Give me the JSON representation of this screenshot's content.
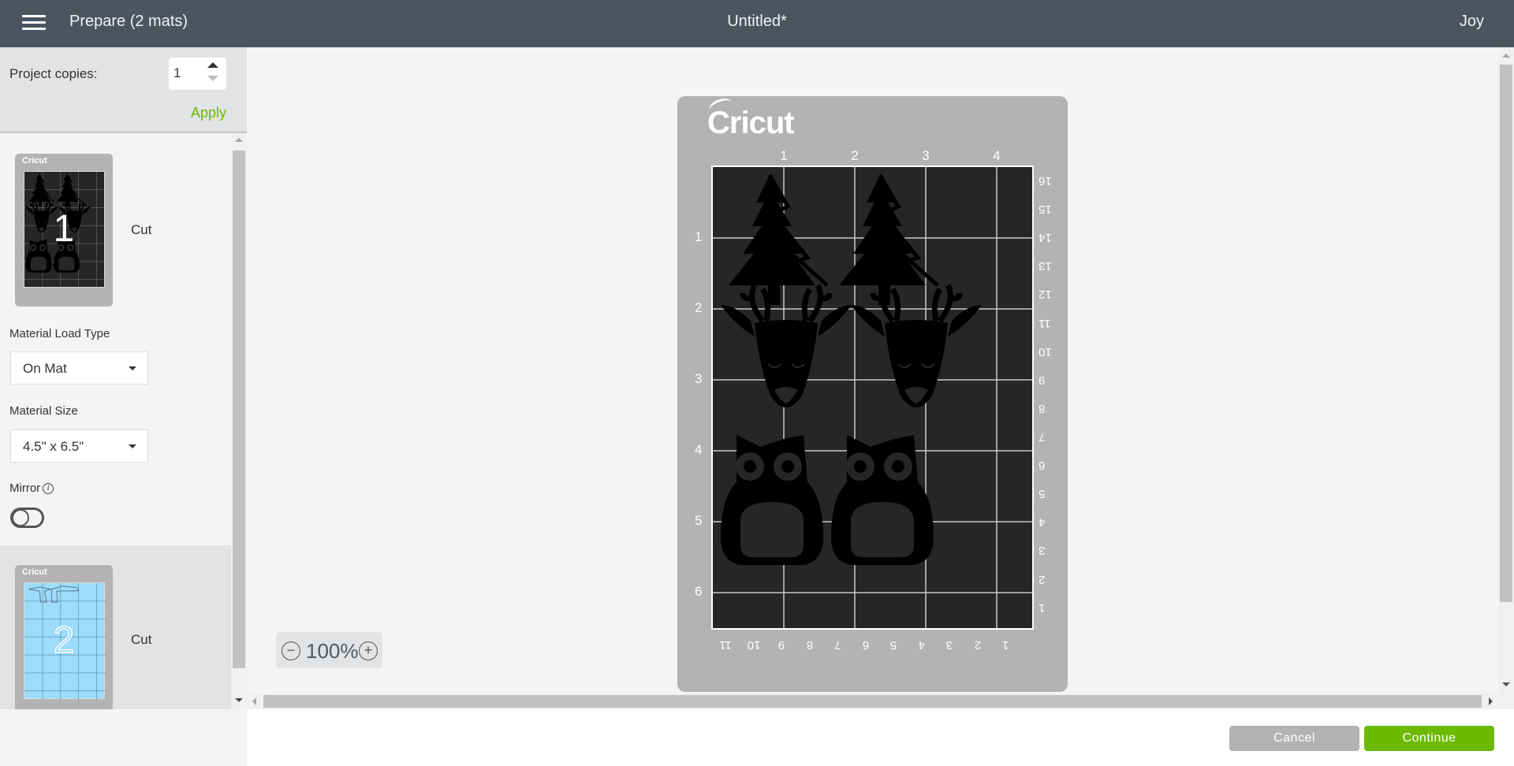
{
  "header": {
    "menu_icon": "hamburger-menu-icon",
    "title": "Prepare (2 mats)",
    "project_name": "Untitled*",
    "user": "Joy"
  },
  "sidebar": {
    "project_copies_label": "Project copies:",
    "project_copies_value": "1",
    "apply_label": "Apply",
    "mats": [
      {
        "number": "1",
        "brand": "Cricut",
        "action": "Cut",
        "material_color": "#262626",
        "contents": [
          "tree",
          "tree",
          "deer",
          "deer",
          "owl",
          "owl"
        ]
      },
      {
        "number": "2",
        "brand": "Cricut",
        "action": "Cut",
        "material_color": "#9edcfb",
        "contents": [
          "outline-shape",
          "outline-shape"
        ]
      }
    ],
    "material_load_type_label": "Material Load Type",
    "material_load_type_value": "On Mat",
    "material_size_label": "Material Size",
    "material_size_value": "4.5\" x 6.5\"",
    "mirror_label": "Mirror",
    "mirror_on": false
  },
  "canvas": {
    "mat": {
      "brand": "Cricut",
      "material_color": "#262626",
      "width_in": 4.5,
      "height_in": 6.5,
      "ruler_top": [
        "1",
        "2",
        "3",
        "4"
      ],
      "ruler_left": [
        "1",
        "2",
        "3",
        "4",
        "5",
        "6"
      ],
      "ruler_right": [
        "16",
        "15",
        "14",
        "13",
        "12",
        "11",
        "10",
        "9",
        "8",
        "7",
        "6",
        "5",
        "4",
        "3",
        "2",
        "1"
      ],
      "ruler_bottom": [
        "11",
        "10",
        "9",
        "8",
        "7",
        "6",
        "5",
        "4",
        "3",
        "2",
        "1"
      ]
    },
    "zoom": "100%"
  },
  "footer": {
    "cancel_label": "Cancel",
    "continue_label": "Continue"
  },
  "colors": {
    "header_bg": "#4b5560",
    "accent_green": "#6cba00",
    "mat_gray": "#b3b3b3",
    "panel_gray": "#e2e3e5"
  }
}
